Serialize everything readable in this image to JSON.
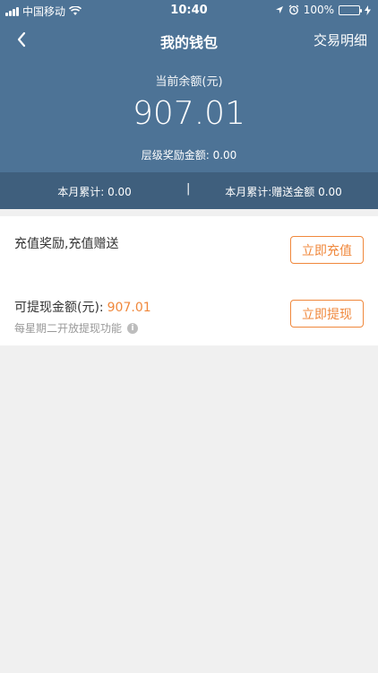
{
  "status_bar": {
    "carrier": "中国移动",
    "time": "10:40",
    "battery": "100%"
  },
  "navbar": {
    "title": "我的钱包",
    "right_link": "交易明细"
  },
  "balance": {
    "label": "当前余额(元)",
    "value": "907.01",
    "tier_reward_label": "层级奖励金额:",
    "tier_reward_value": "0.00"
  },
  "monthly": {
    "left_label": "本月累计:",
    "left_value": "0.00",
    "separator": "|",
    "right_label": "本月累计:",
    "right_sub": "赠送金额",
    "right_value": "0.00"
  },
  "recharge": {
    "text": "充值奖励,充值赠送",
    "button": "立即充值"
  },
  "withdraw": {
    "label": "可提现金额(元):",
    "value": "907.01",
    "note": "每星期二开放提现功能",
    "button": "立即提现"
  },
  "colors": {
    "header_bg": "#4d7396",
    "month_bar_bg": "#3f5f7d",
    "accent": "#f0883c"
  }
}
